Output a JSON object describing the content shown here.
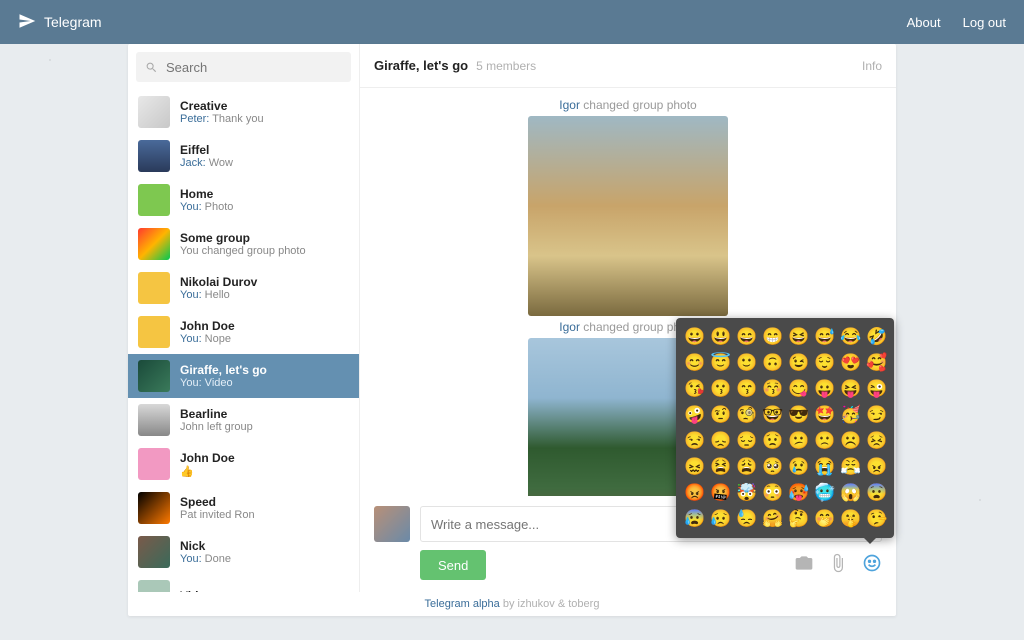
{
  "header": {
    "brand": "Telegram",
    "about": "About",
    "logout": "Log out"
  },
  "search": {
    "placeholder": "Search"
  },
  "chats": [
    {
      "name": "Creative",
      "sender": "Peter:",
      "msg": " Thank you"
    },
    {
      "name": "Eiffel",
      "sender": "Jack:",
      "msg": " Wow"
    },
    {
      "name": "Home",
      "sender": "You:",
      "msg": " Photo"
    },
    {
      "name": "Some group",
      "sender": "",
      "msg": "You changed group photo"
    },
    {
      "name": "Nikolai Durov",
      "sender": "You:",
      "msg": " Hello"
    },
    {
      "name": "John Doe",
      "sender": "You:",
      "msg": " Nope"
    },
    {
      "name": "Giraffe, let's go",
      "sender": "You:",
      "msg": " Video",
      "selected": true
    },
    {
      "name": "Bearline",
      "sender": "",
      "msg": "John left group"
    },
    {
      "name": "John Doe",
      "sender": "",
      "msg": "👍"
    },
    {
      "name": "Speed",
      "sender": "",
      "msg": "Pat invited Ron"
    },
    {
      "name": "Nick",
      "sender": "You:",
      "msg": " Done"
    },
    {
      "name": "Video",
      "sender": "",
      "msg": ""
    }
  ],
  "convo": {
    "title": "Giraffe, let's go",
    "members": "5 members",
    "info": "Info",
    "sys1_who": "Igor",
    "sys1_txt": " changed group photo",
    "sys2_who": "Igor",
    "sys2_txt": " changed group photo",
    "placeholder": "Write a message...",
    "send": "Send"
  },
  "emoji": [
    "😀",
    "😃",
    "😄",
    "😁",
    "😆",
    "😅",
    "😂",
    "🤣",
    "😊",
    "😇",
    "🙂",
    "🙃",
    "😉",
    "😌",
    "😍",
    "🥰",
    "😘",
    "😗",
    "😙",
    "😚",
    "😋",
    "😛",
    "😝",
    "😜",
    "🤪",
    "🤨",
    "🧐",
    "🤓",
    "😎",
    "🤩",
    "🥳",
    "😏",
    "😒",
    "😞",
    "😔",
    "😟",
    "😕",
    "🙁",
    "☹️",
    "😣",
    "😖",
    "😫",
    "😩",
    "🥺",
    "😢",
    "😭",
    "😤",
    "😠",
    "😡",
    "🤬",
    "🤯",
    "😳",
    "🥵",
    "🥶",
    "😱",
    "😨",
    "😰",
    "😥",
    "😓",
    "🤗",
    "🤔",
    "🤭",
    "🤫",
    "🤥"
  ],
  "footer": {
    "tg": "Telegram alpha",
    "by": " by izhukov & toberg"
  }
}
